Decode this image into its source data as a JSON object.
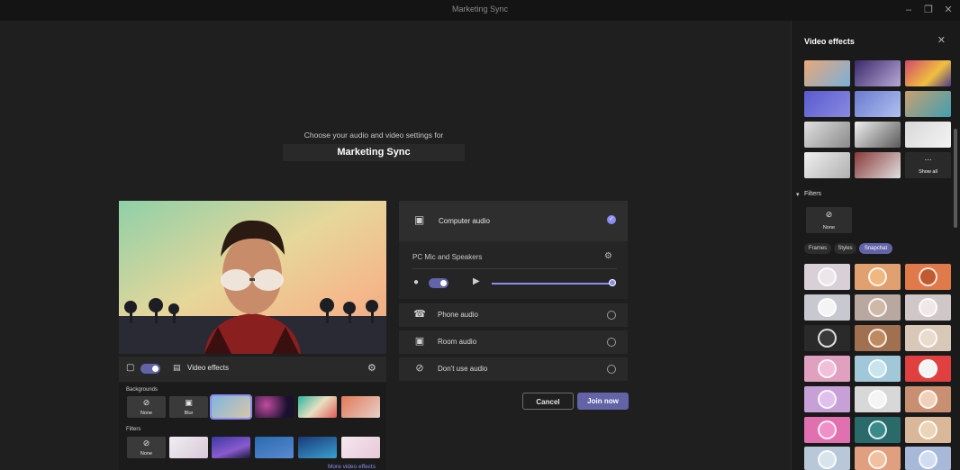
{
  "window": {
    "title": "Marketing Sync"
  },
  "prejoin": {
    "prompt": "Choose your audio and video settings for",
    "meeting_name": "Marketing Sync"
  },
  "video_controls": {
    "camera_on": true,
    "video_effects_label": "Video effects"
  },
  "effects_box": {
    "backgrounds_label": "Backgrounds",
    "background_tiles": [
      {
        "label": "None",
        "icon": "none-icon"
      },
      {
        "label": "Blur",
        "icon": "blur-icon"
      },
      {
        "label": "",
        "selected": true
      },
      {
        "label": ""
      },
      {
        "label": ""
      },
      {
        "label": ""
      }
    ],
    "filters_label": "Filters",
    "filter_tiles": [
      {
        "label": "None",
        "icon": "none-icon"
      },
      {
        "label": ""
      },
      {
        "label": ""
      },
      {
        "label": ""
      },
      {
        "label": ""
      },
      {
        "label": ""
      }
    ],
    "more_link": "More video effects"
  },
  "audio": {
    "computer_audio": {
      "label": "Computer audio",
      "selected": true
    },
    "device_label": "PC Mic and Speakers",
    "mic_on": true,
    "volume": 1.0,
    "phone_audio": "Phone audio",
    "room_audio": "Room audio",
    "dont_use_audio": "Don't use audio"
  },
  "actions": {
    "cancel": "Cancel",
    "join": "Join now"
  },
  "side_panel": {
    "title": "Video effects",
    "show_all": "Show all",
    "filters_section": "Filters",
    "none_label": "None",
    "chips": [
      "Frames",
      "Styles",
      "Snapchat"
    ],
    "active_chip": "Snapchat"
  },
  "colors": {
    "accent": "#6264a7",
    "link": "#8b8df0"
  }
}
